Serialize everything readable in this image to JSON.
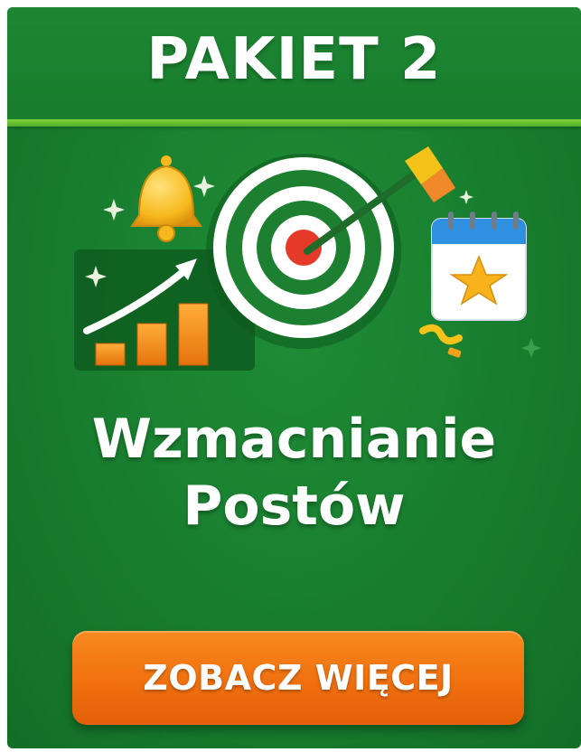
{
  "header": {
    "title": "PAKIET 2"
  },
  "main": {
    "title_line_1": "Wzmacnianie",
    "title_line_2": "Postów"
  },
  "cta": {
    "label": "ZOBACZ WIĘCEJ"
  },
  "illustration": {
    "icons": [
      "bell-icon",
      "growth-chart-icon",
      "target-icon",
      "arrow-icon",
      "calendar-star-icon",
      "sparkle-icon",
      "confetti-icon"
    ]
  },
  "colors": {
    "background_green": "#19802f",
    "accent_line": "#6cc634",
    "button_orange": "#f07a14",
    "text_white": "#ffffff",
    "target_red": "#e53a28",
    "calendar_blue": "#2f8fe0",
    "star_yellow": "#f7b21c"
  }
}
